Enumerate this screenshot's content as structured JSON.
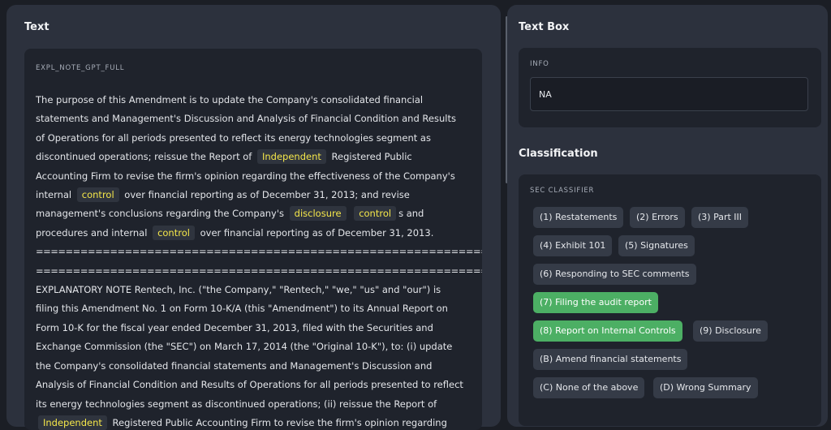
{
  "left": {
    "title": "Text",
    "field_label": "EXPL_NOTE_GPT_FULL",
    "paragraph1": [
      {
        "t": " The purpose of this Amendment is to update the Company's consolidated financial statements and Management's Discussion and Analysis of Financial Condition and Results of Operations for all periods presented to reflect its energy technologies segment as discontinued operations; reissue the Report of "
      },
      {
        "t": "Independent",
        "hl": true
      },
      {
        "t": " Registered Public Accounting Firm to revise the firm's opinion regarding the effectiveness of the Company's internal "
      },
      {
        "t": "control",
        "hl": true
      },
      {
        "t": " over financial reporting as of December 31, 2013; and revise management's conclusions regarding the Company's "
      },
      {
        "t": "disclosure",
        "hl": true
      },
      {
        "t": " "
      },
      {
        "t": "control",
        "hl": true
      },
      {
        "t": "s and procedures and internal "
      },
      {
        "t": "control",
        "hl": true
      },
      {
        "t": " over financial reporting as of December 31, 2013."
      }
    ],
    "separator": "==========================================================================================================",
    "paragraph2": [
      {
        "t": "EXPLANATORY NOTE Rentech, Inc. (\"the Company,\" \"Rentech,\" \"we,\" \"us\" and \"our\") is filing this Amendment No. 1 on Form 10-K/A (this \"Amendment\") to its Annual Report on Form 10-K for the fiscal year ended December 31, 2013, filed with the Securities and Exchange Commission (the \"SEC\") on March 17, 2014 (the \"Original 10-K\"), to: (i) update the Company's consolidated financial statements and Management's Discussion and Analysis of Financial Condition and Results of Operations for all periods presented to reflect its energy technologies segment as discontinued operations; (ii) reissue the Report of "
      },
      {
        "t": "Independent",
        "hl": true
      },
      {
        "t": " Registered Public Accounting Firm to revise the firm's opinion regarding"
      }
    ]
  },
  "right": {
    "textbox_title": "Text Box",
    "info_label": "INFO",
    "info_value": "NA",
    "classification_title": "Classification",
    "classifier_label": "SEC CLASSIFIER",
    "options": [
      {
        "label": "(1) Restatements",
        "selected": false
      },
      {
        "label": "(2) Errors",
        "selected": false
      },
      {
        "label": "(3) Part III",
        "selected": false
      },
      {
        "label": "(4) Exhibit 101",
        "selected": false
      },
      {
        "label": "(5) Signatures",
        "selected": false
      },
      {
        "label": "(6) Responding to SEC comments",
        "selected": false
      },
      {
        "label": "(7) Filing the audit report",
        "selected": true
      },
      {
        "label": "(8) Report on Internal Controls",
        "selected": true
      },
      {
        "label": "(9) Disclosure",
        "selected": false
      },
      {
        "label": "(B) Amend financial statements",
        "selected": false
      },
      {
        "label": "(C) None of the above",
        "selected": false
      },
      {
        "label": "(D) Wrong Summary",
        "selected": false
      }
    ]
  },
  "colors": {
    "selected_chip": "#4caf64",
    "highlight_text": "#f5e74a"
  }
}
